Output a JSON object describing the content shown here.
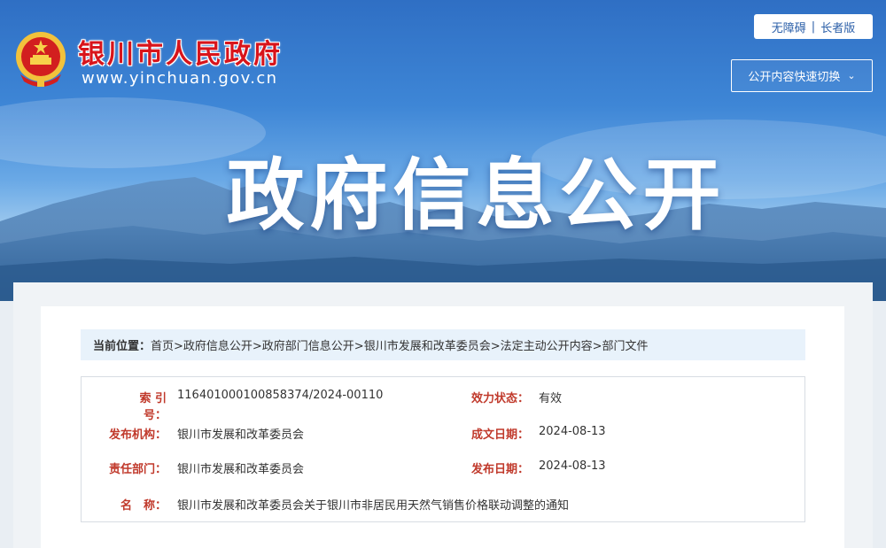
{
  "header": {
    "site_name": "银川市人民政府",
    "site_url": "www.yinchuan.gov.cn",
    "accessibility": "无障碍",
    "separator": "|",
    "elderly_mode": "长者版",
    "switch_button": "公开内容快速切换",
    "banner_title": "政府信息公开"
  },
  "breadcrumb": {
    "label": "当前位置：",
    "path": "首页>政府信息公开>政府部门信息公开>银川市发展和改革委员会>法定主动公开内容>部门文件"
  },
  "info": {
    "index_label": "索 引 号：",
    "index_value": "116401000100858374/2024-00110",
    "status_label": "效力状态：",
    "status_value": "有效",
    "publisher_label": "发布机构：",
    "publisher_value": "银川市发展和改革委员会",
    "created_label": "成文日期：",
    "created_value": "2024-08-13",
    "dept_label": "责任部门：",
    "dept_value": "银川市发展和改革委员会",
    "published_label": "发布日期：",
    "published_value": "2024-08-13",
    "name_label": "名　称：",
    "name_value": "银川市发展和改革委员会关于银川市非居民用天然气销售价格联动调整的通知"
  },
  "colors": {
    "brand_red": "#d8141b",
    "label_red": "#c0392b",
    "link_blue": "#2b5fa8",
    "breadcrumb_bg": "#e8f2fb"
  }
}
